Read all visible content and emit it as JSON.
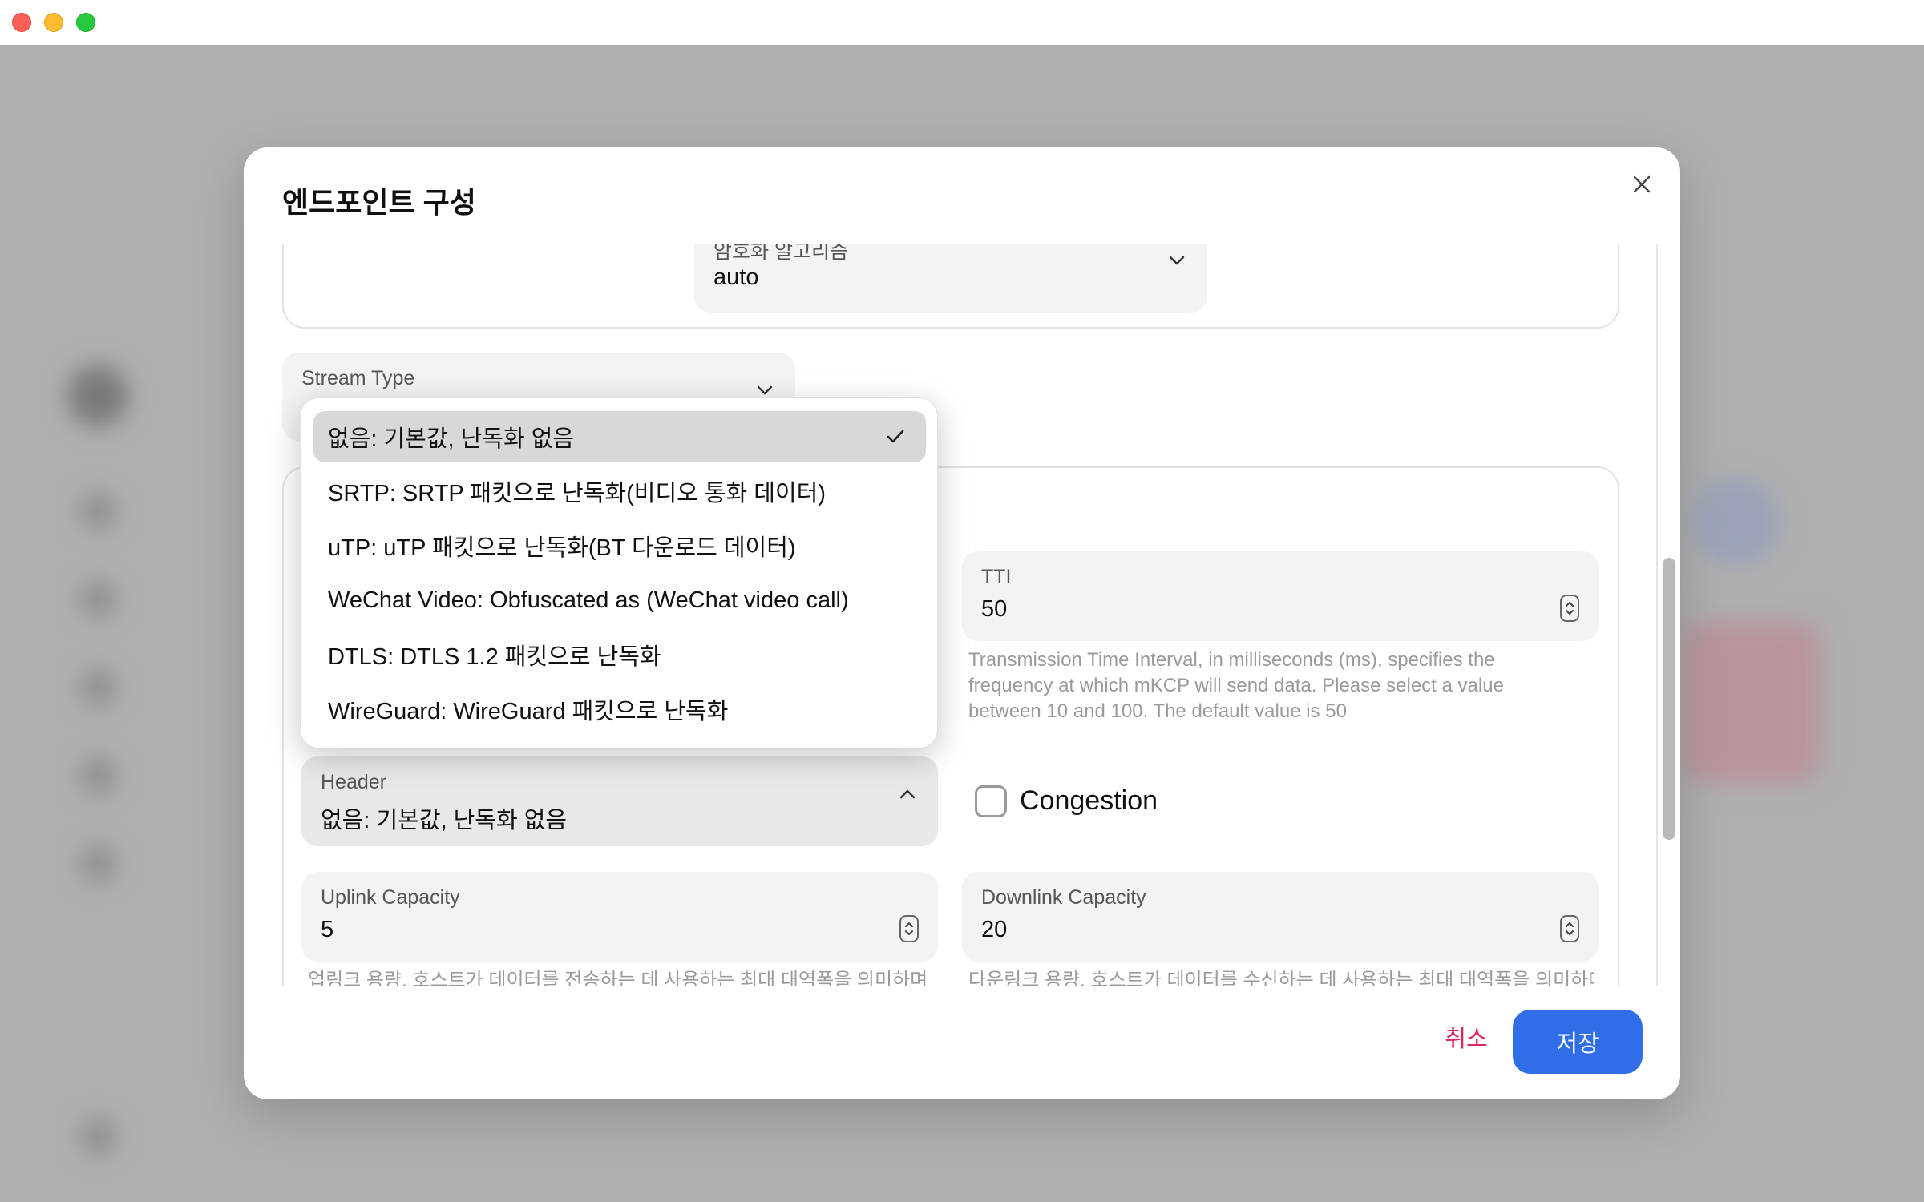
{
  "dialog": {
    "title": "엔드포인트 구성",
    "close_icon": "close-icon"
  },
  "encryption": {
    "label": "암호화 알고리즘",
    "value": "auto"
  },
  "stream_type": {
    "label": "Stream Type",
    "value": ""
  },
  "tti": {
    "label": "TTI",
    "value": "50",
    "helper": "Transmission Time Interval, in milliseconds (ms), specifies the frequency at which mKCP will send data. Please select a value between 10 and 100. The default value is 50"
  },
  "header": {
    "label": "Header",
    "value": "없음: 기본값, 난독화 없음",
    "options": [
      {
        "label": "없음: 기본값, 난독화 없음",
        "selected": true
      },
      {
        "label": "SRTP: SRTP 패킷으로 난독화(비디오 통화 데이터)",
        "selected": false
      },
      {
        "label": "uTP: uTP 패킷으로 난독화(BT 다운로드 데이터)",
        "selected": false
      },
      {
        "label": "WeChat Video: Obfuscated as (WeChat video call)",
        "selected": false
      },
      {
        "label": "DTLS: DTLS 1.2 패킷으로 난독화",
        "selected": false
      },
      {
        "label": "WireGuard: WireGuard 패킷으로 난독화",
        "selected": false
      }
    ]
  },
  "congestion": {
    "label": "Congestion",
    "checked": false
  },
  "uplink": {
    "label": "Uplink Capacity",
    "value": "5",
    "helper": "업링크 용량, 호스트가 데이터를 전송하는 데 사용하는 최대 대역폭을 의미하며"
  },
  "downlink": {
    "label": "Downlink Capacity",
    "value": "20",
    "helper": "다운링크 용량, 호스트가 데이터를 수신하는 데 사용하는 최대 대역폭을 의미하며"
  },
  "footer": {
    "cancel": "취소",
    "save": "저장"
  },
  "colors": {
    "accent": "#2f6ee6",
    "cancel": "#e0245e"
  }
}
